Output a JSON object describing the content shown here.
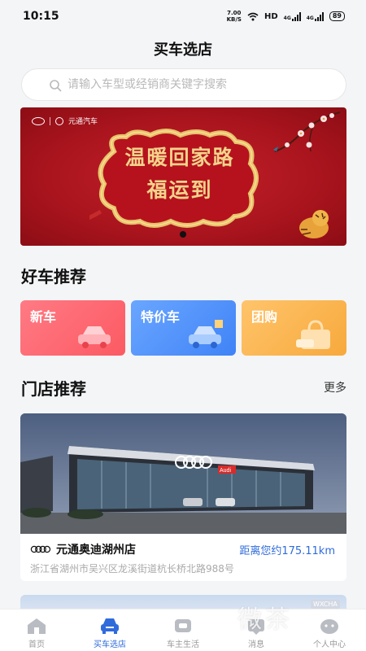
{
  "status_bar": {
    "time": "10:15",
    "net_speed_value": "7.00",
    "net_speed_unit": "KB/S",
    "hd_label": "HD",
    "sim1_label": "4G",
    "sim2_label": "4G",
    "battery": "89"
  },
  "header": {
    "title": "买车选店"
  },
  "search": {
    "placeholder": "请输入车型或经销商关键字搜索"
  },
  "banner": {
    "brand_text": "元通汽车",
    "line1": "温暖回家路",
    "line2": "福运到",
    "active_slide": 1,
    "slide_count": 2
  },
  "section_cars": {
    "title": "好车推荐"
  },
  "categories": [
    {
      "label": "新车",
      "color": "#fc5a63"
    },
    {
      "label": "特价车",
      "color": "#3f83f7"
    },
    {
      "label": "团购",
      "color": "#f7a93c"
    }
  ],
  "section_stores": {
    "title": "门店推荐",
    "more_label": "更多"
  },
  "store": {
    "sign_text": "Audi",
    "name": "元通奥迪湖州店",
    "distance": "距离您约175.11km",
    "address": "浙江省湖州市吴兴区龙溪街道杭长桥北路988号"
  },
  "tabs": [
    {
      "label": "首页",
      "icon": "home-icon",
      "active": false
    },
    {
      "label": "买车选店",
      "icon": "car-icon",
      "active": true
    },
    {
      "label": "车主生活",
      "icon": "car-life-icon",
      "active": false
    },
    {
      "label": "消息",
      "icon": "message-icon",
      "active": false
    },
    {
      "label": "个人中心",
      "icon": "profile-icon",
      "active": false
    }
  ],
  "watermark": {
    "text": "微茶",
    "tag": "WXCHA"
  },
  "colors": {
    "accent": "#2f6bdb",
    "background": "#f4f5f7"
  }
}
